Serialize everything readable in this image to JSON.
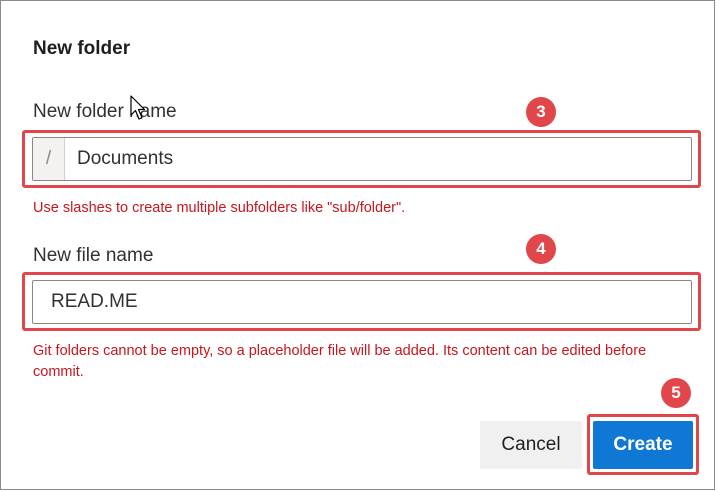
{
  "dialog": {
    "title": "New folder"
  },
  "folder_field": {
    "label": "New folder name",
    "prefix": "/",
    "value": "Documents",
    "hint": "Use slashes to create multiple subfolders like \"sub/folder\"."
  },
  "file_field": {
    "label": "New file name",
    "value": "READ.ME",
    "hint": "Git folders cannot be empty, so a placeholder file will be added. Its content can be edited before commit."
  },
  "buttons": {
    "cancel_label": "Cancel",
    "create_label": "Create"
  },
  "annotations": {
    "folder_step": "3",
    "file_step": "4",
    "create_step": "5",
    "color": "#e0464a"
  },
  "colors": {
    "accent": "#0f78d4",
    "error": "#c8161d"
  }
}
